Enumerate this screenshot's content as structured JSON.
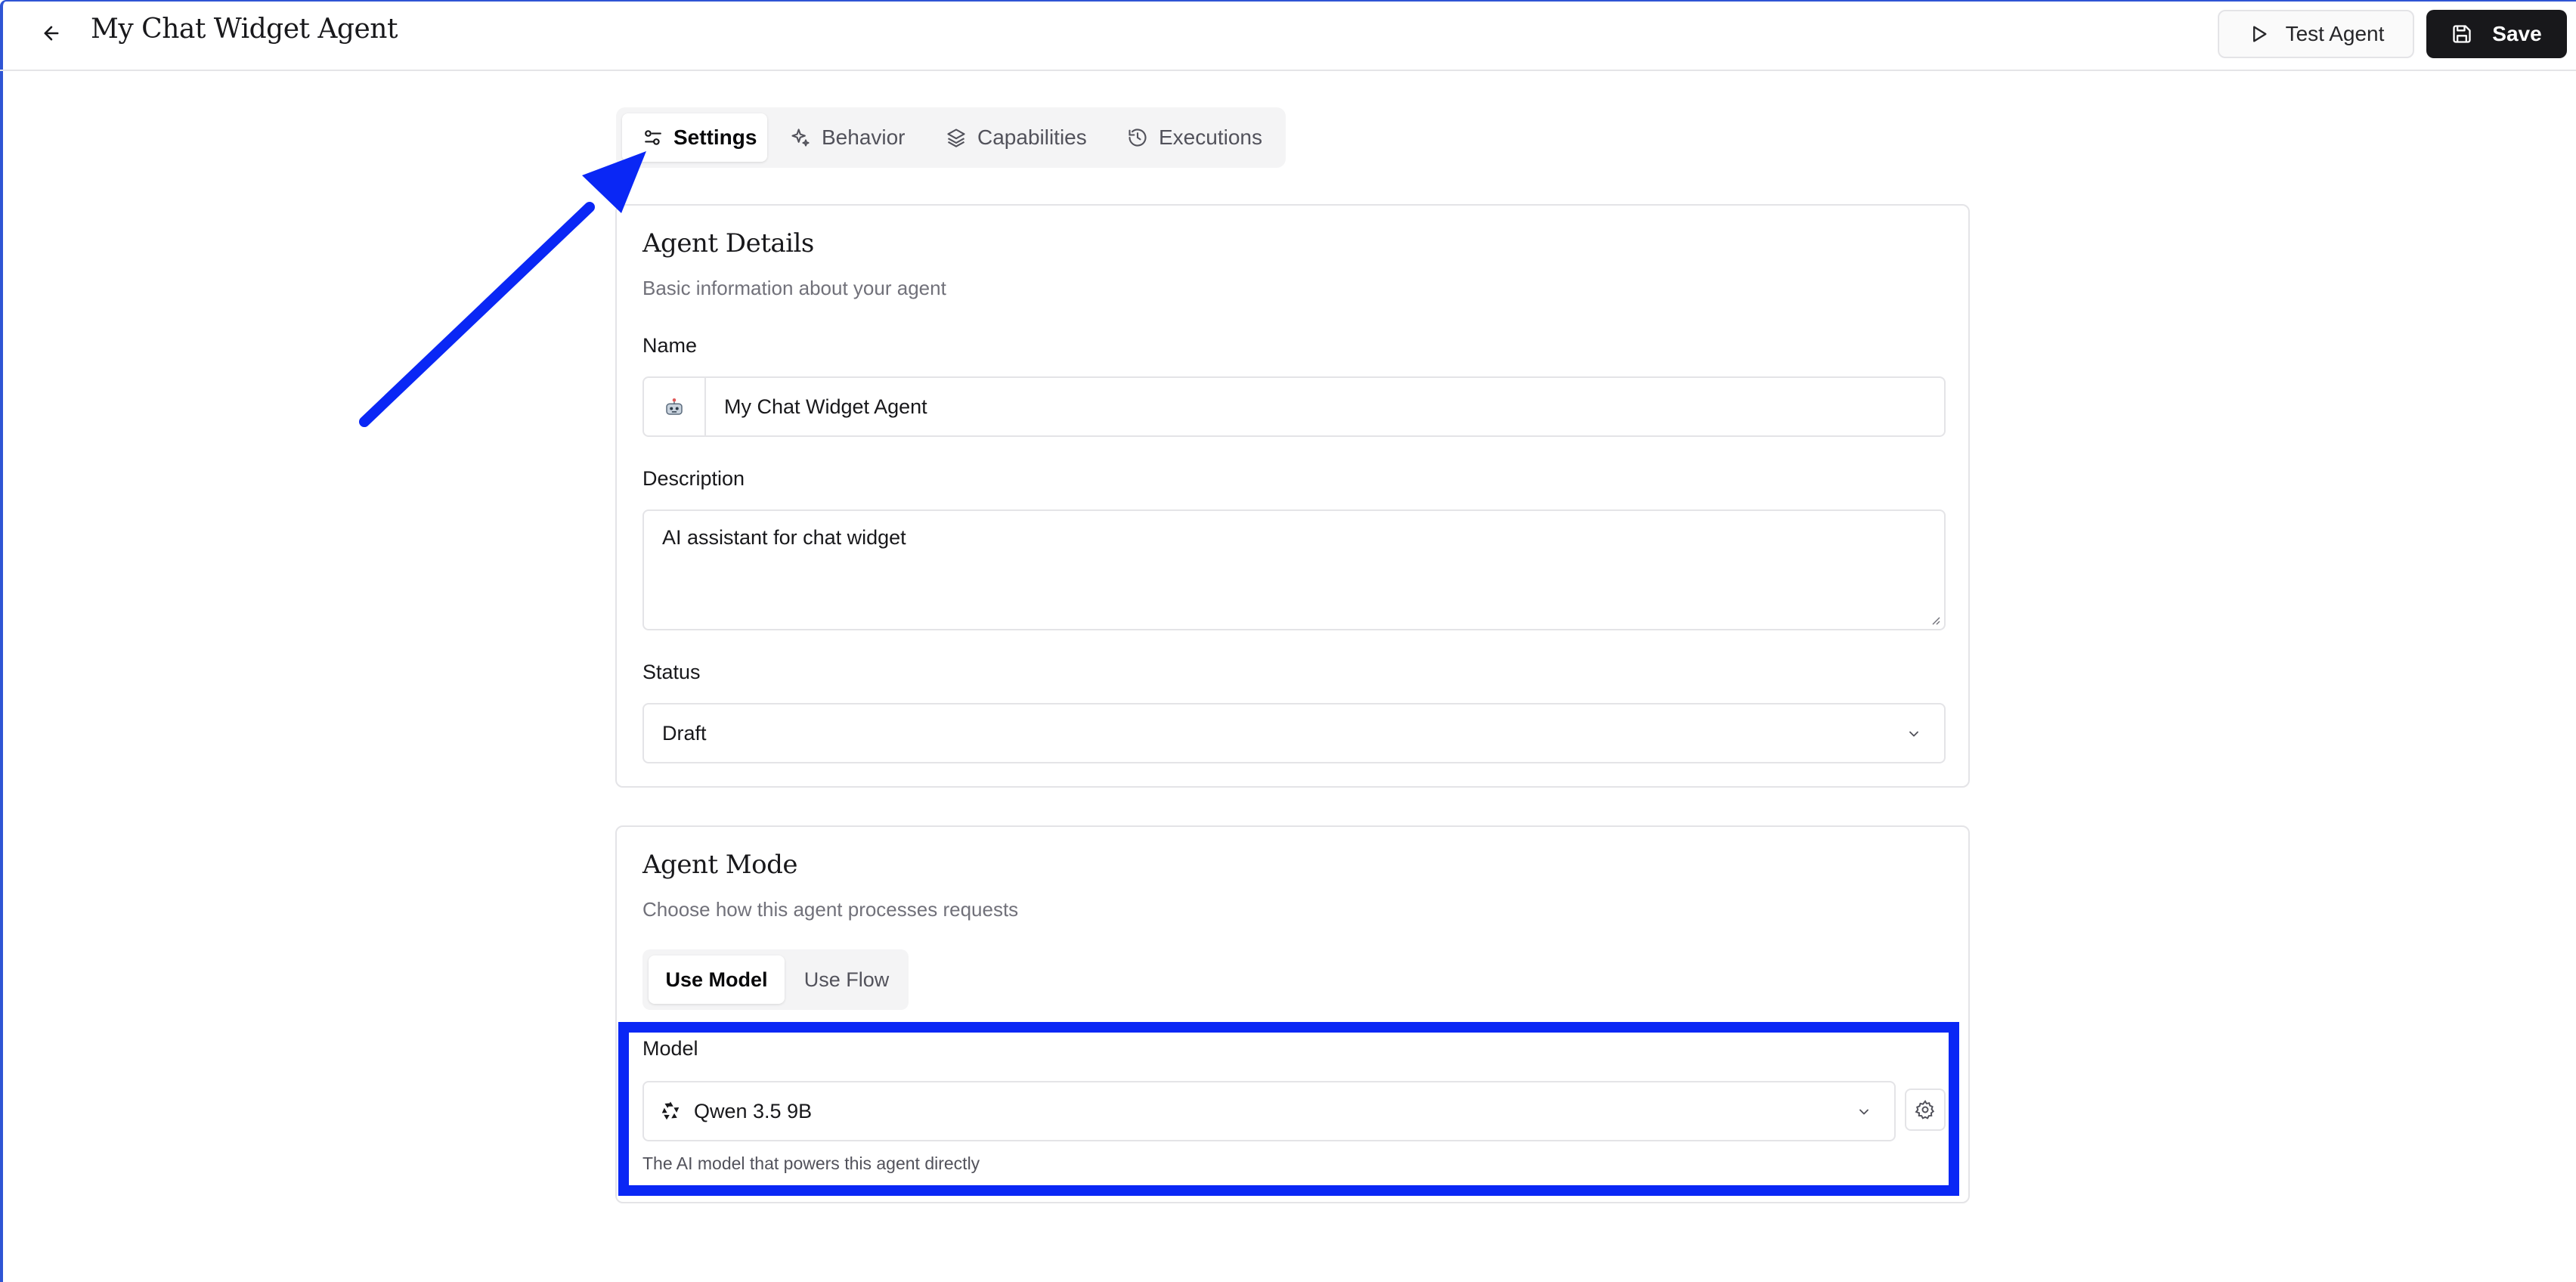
{
  "header": {
    "title": "My Chat Widget Agent",
    "test_label": "Test Agent",
    "save_label": "Save"
  },
  "tabs": [
    {
      "label": "Settings",
      "icon": "sliders-icon",
      "active": true
    },
    {
      "label": "Behavior",
      "icon": "sparkles-icon",
      "active": false
    },
    {
      "label": "Capabilities",
      "icon": "layers-icon",
      "active": false
    },
    {
      "label": "Executions",
      "icon": "history-icon",
      "active": false
    }
  ],
  "details": {
    "title": "Agent Details",
    "subtitle": "Basic information about your agent",
    "name_label": "Name",
    "name_value": "My Chat Widget Agent",
    "description_label": "Description",
    "description_value": "AI assistant for chat widget",
    "status_label": "Status",
    "status_value": "Draft"
  },
  "mode": {
    "title": "Agent Mode",
    "subtitle": "Choose how this agent processes requests",
    "options": [
      "Use Model",
      "Use Flow"
    ],
    "selected": "Use Model",
    "model_label": "Model",
    "model_value": "Qwen 3.5 9B",
    "model_help": "The AI model that powers this agent directly"
  },
  "colors": {
    "annotation": "#0a27f5",
    "primary_button": "#18181b",
    "border": "#e4e4e7",
    "muted_text": "#71717a"
  }
}
